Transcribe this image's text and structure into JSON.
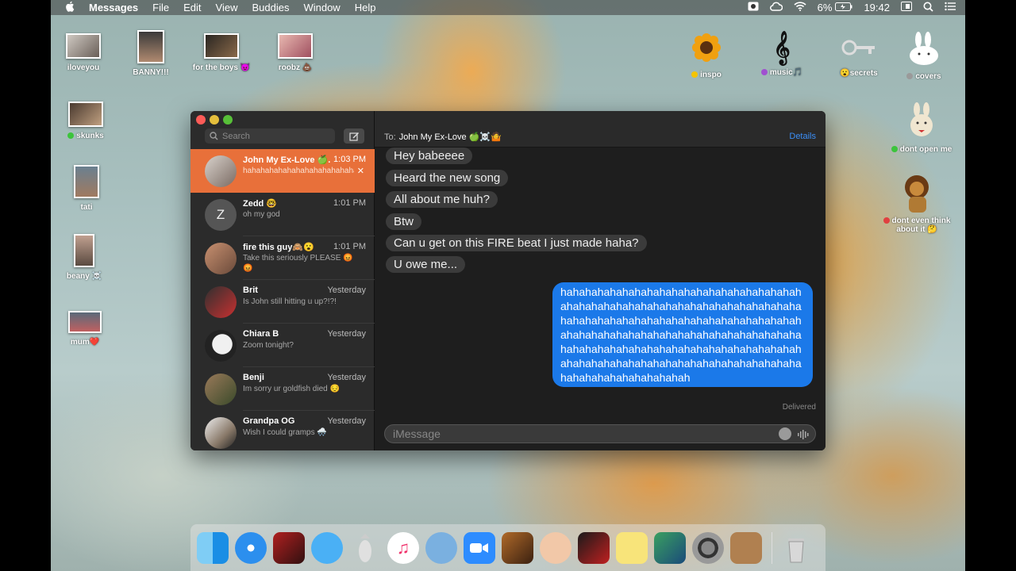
{
  "menubar": {
    "app_name": "Messages",
    "menus": [
      "File",
      "Edit",
      "View",
      "Buddies",
      "Window",
      "Help"
    ],
    "battery": "6%",
    "time": "19:42"
  },
  "desktop_icons": [
    {
      "label": "iloveyou"
    },
    {
      "label": "BANNY!!!"
    },
    {
      "label": "for the boys 😈"
    },
    {
      "label": "roobz 💩"
    },
    {
      "label": "skunks"
    },
    {
      "label": "tati"
    },
    {
      "label": "beany ☠️"
    },
    {
      "label": "mum❤️"
    },
    {
      "label": "inspo",
      "tag": "#f5c400"
    },
    {
      "label": "music🎵",
      "tag": "#a050d0"
    },
    {
      "label": "😮secrets"
    },
    {
      "label": "covers",
      "tag": "#9a9a9a"
    },
    {
      "label": "dont open me",
      "tag": "#3cc43c"
    },
    {
      "label": "dont even think about it 🤔",
      "tag": "#e04040"
    }
  ],
  "sidebar": {
    "search_placeholder": "Search",
    "conversations": [
      {
        "name": "John My Ex-Love 🍏...",
        "time": "1:03 PM",
        "preview": "hahahahahahahahahahahahahahahahahahahahahahahahahahahahaha",
        "selected": true
      },
      {
        "name": "Zedd 🤓",
        "time": "1:01 PM",
        "preview": "oh my god",
        "avatar_letter": "Z"
      },
      {
        "name": "fire this guy🙈😮",
        "time": "1:01 PM",
        "preview": "Take this seriously PLEASE 😡😡"
      },
      {
        "name": "Brit",
        "time": "Yesterday",
        "preview": "Is John still hitting u up?!?!"
      },
      {
        "name": "Chiara B",
        "time": "Yesterday",
        "preview": "Zoom tonight?"
      },
      {
        "name": "Benji",
        "time": "Yesterday",
        "preview": "Im sorry ur goldfish died 😔"
      },
      {
        "name": "Grandpa OG",
        "time": "Yesterday",
        "preview": "Wish I could gramps 🌨️"
      }
    ]
  },
  "chat": {
    "to_label": "To:",
    "recipient": "John My Ex-Love 🍏☠️🤷",
    "details_label": "Details",
    "received": [
      "Hey babeeee",
      "Heard the new song",
      "All about me huh?",
      "Btw",
      "Can u get on this FIRE beat I just made haha?",
      "U owe me..."
    ],
    "sent": "hahahahahahahahahahahahahahahahahahahahahahahahahahahahahahahahahahahahahahahahahahahahahahahahahahahahahahahahahahahahahahahahahahahahahahahahahahahahahahahahahahahahahahahahahahahahahahahahahahahahahahahahahahahahahahahahahahahahahahahahahahahahahahahah",
    "status": "Delivered",
    "input_placeholder": "iMessage"
  },
  "dock": {
    "apps": [
      "finder",
      "safari",
      "photo-booth",
      "messages",
      "inkscape",
      "music",
      "sequel",
      "zoom",
      "garageband",
      "face",
      "photo-app",
      "stickies",
      "preview",
      "system-preferences",
      "contacts",
      "trash"
    ]
  }
}
